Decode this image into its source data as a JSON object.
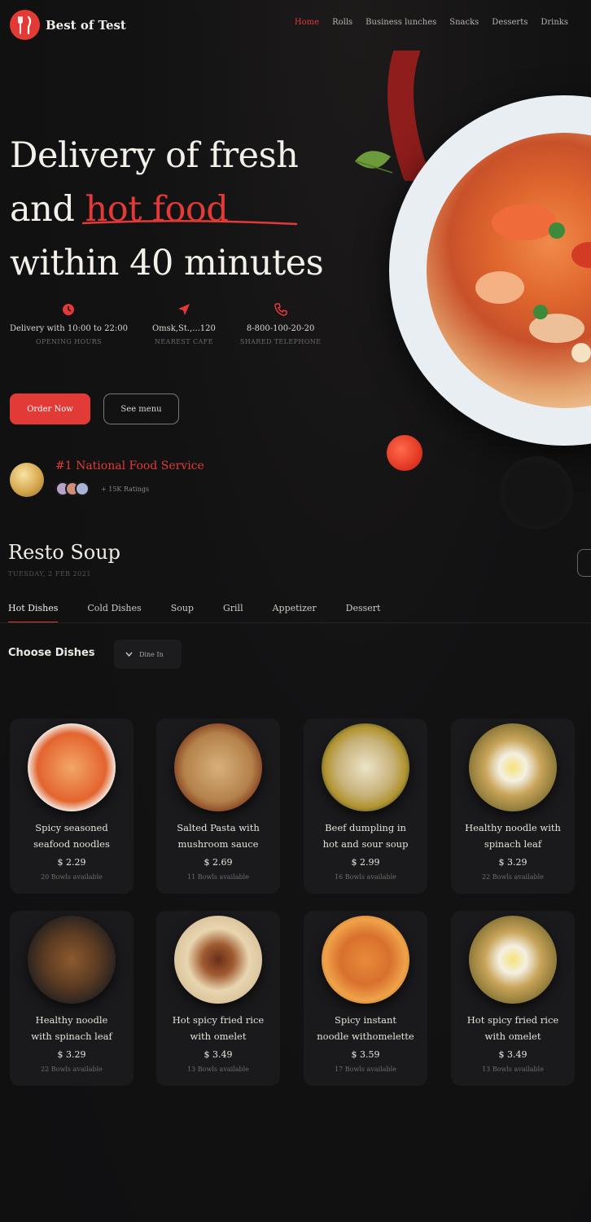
{
  "brand": {
    "name": "Best of Test"
  },
  "nav": [
    {
      "label": "Home",
      "active": true
    },
    {
      "label": "Rolls",
      "active": false
    },
    {
      "label": "Business lunches",
      "active": false
    },
    {
      "label": "Snacks",
      "active": false
    },
    {
      "label": "Desserts",
      "active": false
    },
    {
      "label": "Drinks",
      "active": false
    }
  ],
  "hero": {
    "line1": "Delivery of fresh",
    "line2_prefix": "and ",
    "line2_accent": "hot food",
    "line3": "within 40 minutes"
  },
  "info": [
    {
      "icon": "clock-icon",
      "value": "Delivery with 10:00 to 22:00",
      "sub": "OPENING HOURS"
    },
    {
      "icon": "location-arrow-icon",
      "value": "Omsk,St.,...120",
      "sub": "NEAREST CAFE"
    },
    {
      "icon": "phone-icon",
      "value": "8-800-100-20-20",
      "sub": "SHARED TELEPHONE"
    }
  ],
  "buttons": {
    "order": "Order Now",
    "menu": "See menu"
  },
  "award": {
    "title": "#1 National Food Service",
    "reviews": "+ 15K Ratings"
  },
  "section": {
    "title": "Resto Soup",
    "subtitle": "TUESDAY, 2 FEB 2021"
  },
  "tabs": [
    {
      "label": "Hot Dishes",
      "active": true
    },
    {
      "label": "Cold Dishes",
      "active": false
    },
    {
      "label": "Soup",
      "active": false
    },
    {
      "label": "Grill",
      "active": false
    },
    {
      "label": "Appetizer",
      "active": false
    },
    {
      "label": "Dessert",
      "active": false
    }
  ],
  "choose": {
    "title": "Choose Dishes",
    "filter": "Dine In"
  },
  "dishes": [
    {
      "name_1": "Spicy seasoned",
      "name_2": "seafood noodles",
      "price": "$ 2.29",
      "avail": "20 Bowls available"
    },
    {
      "name_1": "Salted Pasta with",
      "name_2": "mushroom sauce",
      "price": "$ 2.69",
      "avail": "11 Bowls available"
    },
    {
      "name_1": "Beef dumpling in",
      "name_2": "hot and sour soup",
      "price": "$ 2.99",
      "avail": "16 Bowls available"
    },
    {
      "name_1": "Healthy noodle with",
      "name_2": "spinach leaf",
      "price": "$ 3.29",
      "avail": "22 Bowls available"
    },
    {
      "name_1": "Healthy noodle",
      "name_2": "with spinach leaf",
      "price": "$ 3.29",
      "avail": "22 Bowls available"
    },
    {
      "name_1": "Hot spicy fried rice",
      "name_2": "with omelet",
      "price": "$ 3.49",
      "avail": "13 Bowls available"
    },
    {
      "name_1": "Spicy instant",
      "name_2": "noodle withomelette",
      "price": "$ 3.59",
      "avail": "17 Bowls available"
    },
    {
      "name_1": "Hot spicy fried rice",
      "name_2": "with omelet",
      "price": "$ 3.49",
      "avail": "13 Bowls available"
    }
  ],
  "colors": {
    "accent": "#e23a37",
    "background": "#111112",
    "card": "#1a1a1c"
  }
}
